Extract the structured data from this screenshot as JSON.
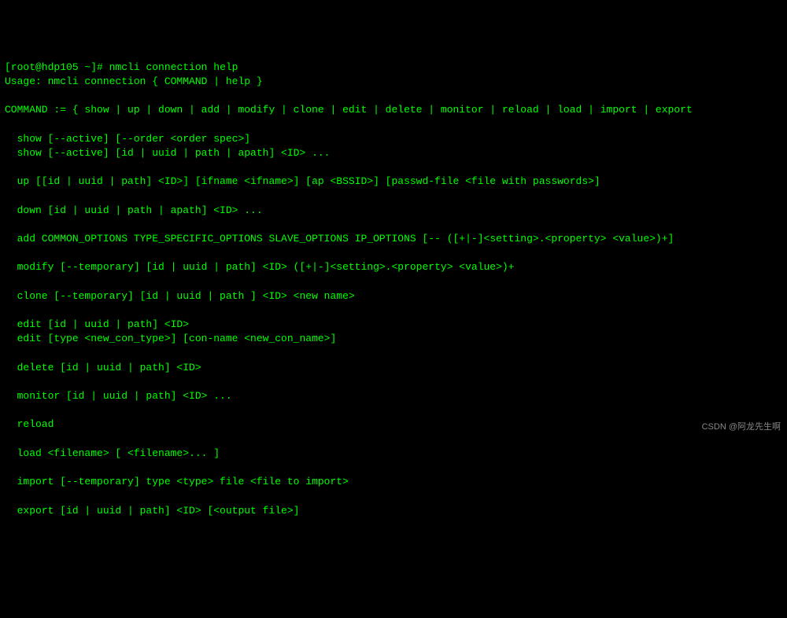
{
  "prompt": {
    "user_host": "[root@hdp105 ~]#",
    "command": "nmcli connection help"
  },
  "output": {
    "usage": "Usage: nmcli connection { COMMAND | help }",
    "command_list": "COMMAND := { show | up | down | add | modify | clone | edit | delete | monitor | reload | load | import | export",
    "syntax": {
      "show1": "  show [--active] [--order <order spec>]",
      "show2": "  show [--active] [id | uuid | path | apath] <ID> ...",
      "up": "  up [[id | uuid | path] <ID>] [ifname <ifname>] [ap <BSSID>] [passwd-file <file with passwords>]",
      "down": "  down [id | uuid | path | apath] <ID> ...",
      "add": "  add COMMON_OPTIONS TYPE_SPECIFIC_OPTIONS SLAVE_OPTIONS IP_OPTIONS [-- ([+|-]<setting>.<property> <value>)+]",
      "modify": "  modify [--temporary] [id | uuid | path] <ID> ([+|-]<setting>.<property> <value>)+",
      "clone": "  clone [--temporary] [id | uuid | path ] <ID> <new name>",
      "edit1": "  edit [id | uuid | path] <ID>",
      "edit2": "  edit [type <new_con_type>] [con-name <new_con_name>]",
      "delete": "  delete [id | uuid | path] <ID>",
      "monitor": "  monitor [id | uuid | path] <ID> ...",
      "reload": "  reload",
      "load": "  load <filename> [ <filename>... ]",
      "import": "  import [--temporary] type <type> file <file to import>",
      "export": "  export [id | uuid | path] <ID> [<output file>]"
    }
  },
  "watermark": "CSDN @阿龙先生啊"
}
